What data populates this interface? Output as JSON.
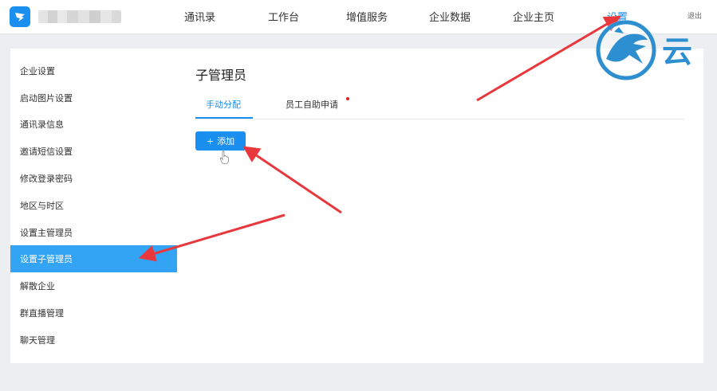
{
  "header": {
    "nav": [
      "通讯录",
      "工作台",
      "增值服务",
      "企业数据",
      "企业主页",
      "设置"
    ],
    "logout_label": "退出"
  },
  "watermark_char": "云",
  "sidebar": {
    "items": [
      {
        "label": "企业设置"
      },
      {
        "label": "启动图片设置"
      },
      {
        "label": "通讯录信息"
      },
      {
        "label": "邀请短信设置"
      },
      {
        "label": "修改登录密码"
      },
      {
        "label": "地区与时区"
      },
      {
        "label": "设置主管理员"
      },
      {
        "label": "设置子管理员"
      },
      {
        "label": "解散企业"
      },
      {
        "label": "群直播管理"
      },
      {
        "label": "聊天管理"
      }
    ],
    "active_index": 7
  },
  "main": {
    "title": "子管理员",
    "tabs": [
      {
        "label": "手动分配"
      },
      {
        "label": "员工自助申请"
      }
    ],
    "add_button": {
      "label": "添加"
    }
  },
  "colors": {
    "accent": "#1b8ff0",
    "sidebar_active": "#33a3f3",
    "annotation_arrow": "#e8383d",
    "notification_dot": "#e02020"
  }
}
